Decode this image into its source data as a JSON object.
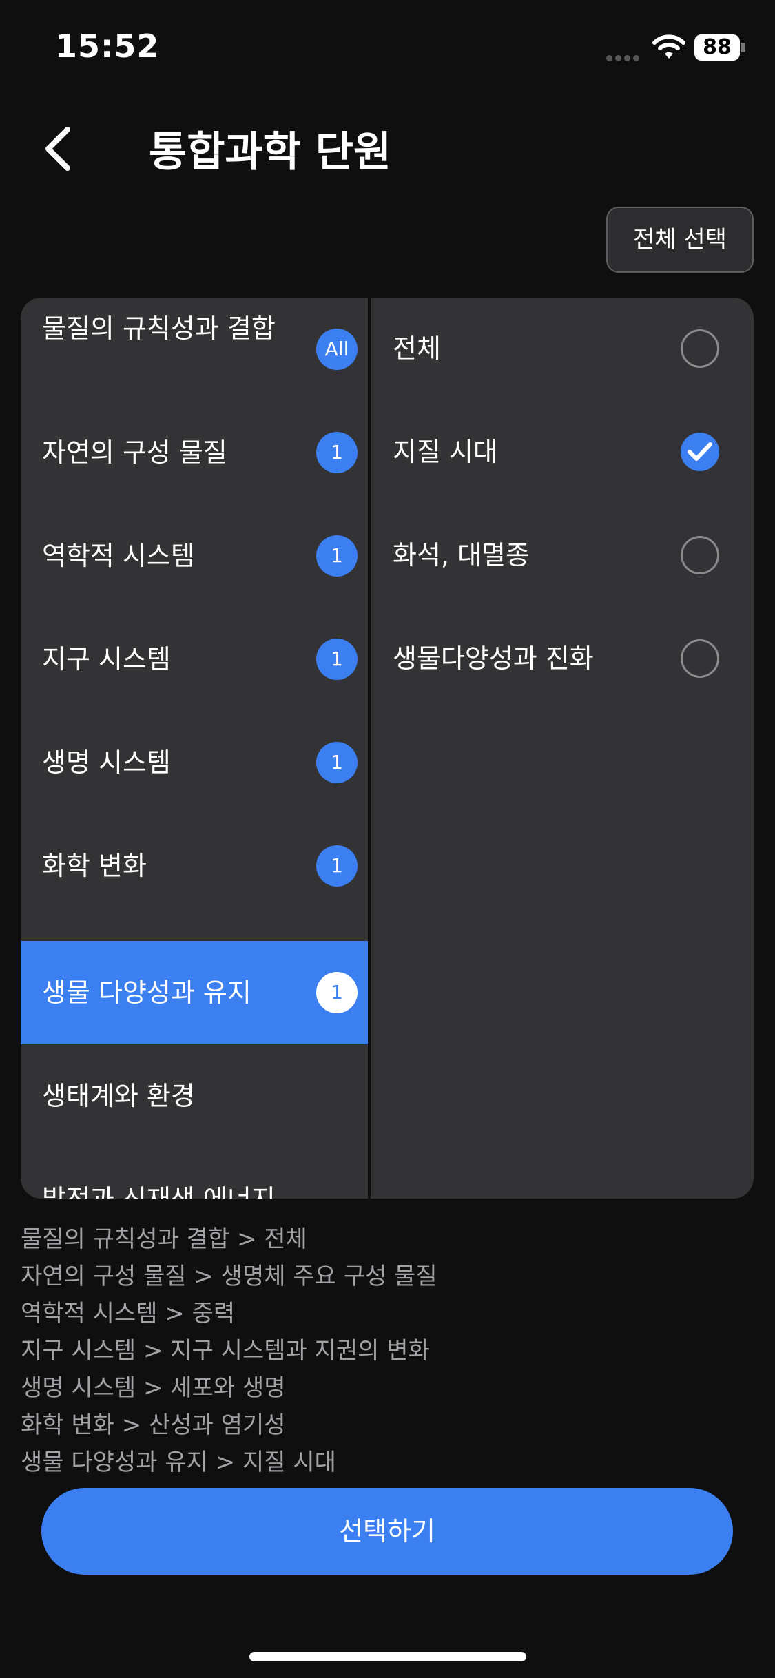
{
  "status_bar": {
    "time": "15:52",
    "battery": "88"
  },
  "header": {
    "title": "통합과학 단원",
    "select_all": "전체 선택"
  },
  "categories": [
    {
      "label": "물질의 규칙성과 결합",
      "badge": "All"
    },
    {
      "label": "자연의 구성 물질",
      "badge": "1"
    },
    {
      "label": "역학적 시스템",
      "badge": "1"
    },
    {
      "label": "지구 시스템",
      "badge": "1"
    },
    {
      "label": "생명 시스템",
      "badge": "1"
    },
    {
      "label": "화학 변화",
      "badge": "1"
    },
    {
      "label": "생물 다양성과 유지",
      "badge": "1",
      "selected": true
    },
    {
      "label": "생태계와 환경",
      "badge": ""
    },
    {
      "label": "발전과 신재생 에너지",
      "badge": ""
    }
  ],
  "options": [
    {
      "label": "전체",
      "checked": false
    },
    {
      "label": "지질 시대",
      "checked": true
    },
    {
      "label": "화석, 대멸종",
      "checked": false
    },
    {
      "label": "생물다양성과 진화",
      "checked": false
    }
  ],
  "summary": [
    "물질의 규칙성과 결합 > 전체",
    "자연의 구성 물질 > 생명체 주요 구성 물질",
    "역학적 시스템 > 중력",
    "지구 시스템 > 지구 시스템과 지권의 변화",
    "생명 시스템 > 세포와 생명",
    "화학 변화 > 산성과 염기성",
    "생물 다양성과 유지 > 지질 시대"
  ],
  "confirm_button": "선택하기",
  "colors": {
    "accent": "#3b7ff1",
    "panel": "#333335",
    "background": "#0f0f10"
  }
}
